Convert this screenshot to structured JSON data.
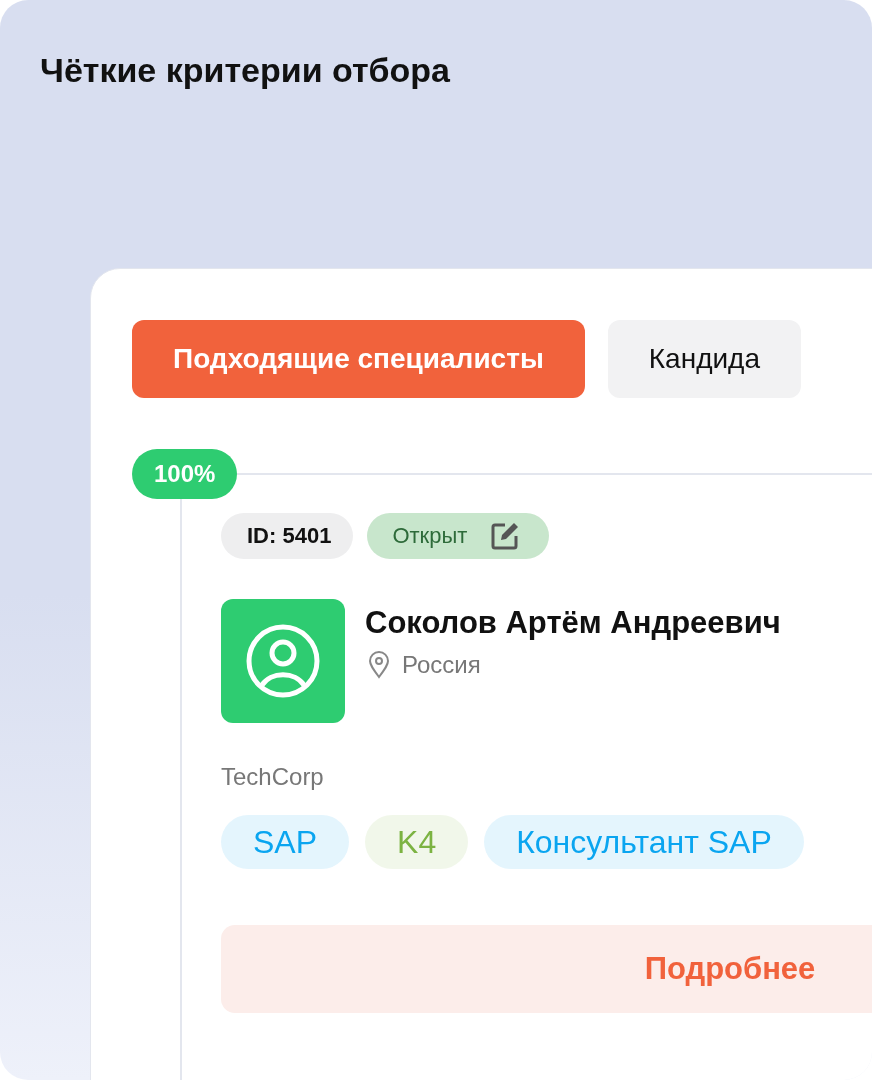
{
  "title": "Чёткие критерии отбора",
  "tabs": [
    {
      "label": "Подходящие специалисты",
      "selected": true
    },
    {
      "label": "Кандида",
      "selected": false
    }
  ],
  "match": {
    "score": "100%"
  },
  "candidate": {
    "id": "ID: 5401",
    "status": "Открыт",
    "name": "Соколов Артём Андреевич",
    "location": "Россия",
    "company": "TechCorp",
    "tags": [
      {
        "label": "SAP",
        "color": "#0aa5f0"
      },
      {
        "label": "K4",
        "color": "#7cb342"
      },
      {
        "label": "Консультант SAP",
        "color": "#0aa5f0"
      }
    ],
    "details_button": "Подробнее"
  }
}
